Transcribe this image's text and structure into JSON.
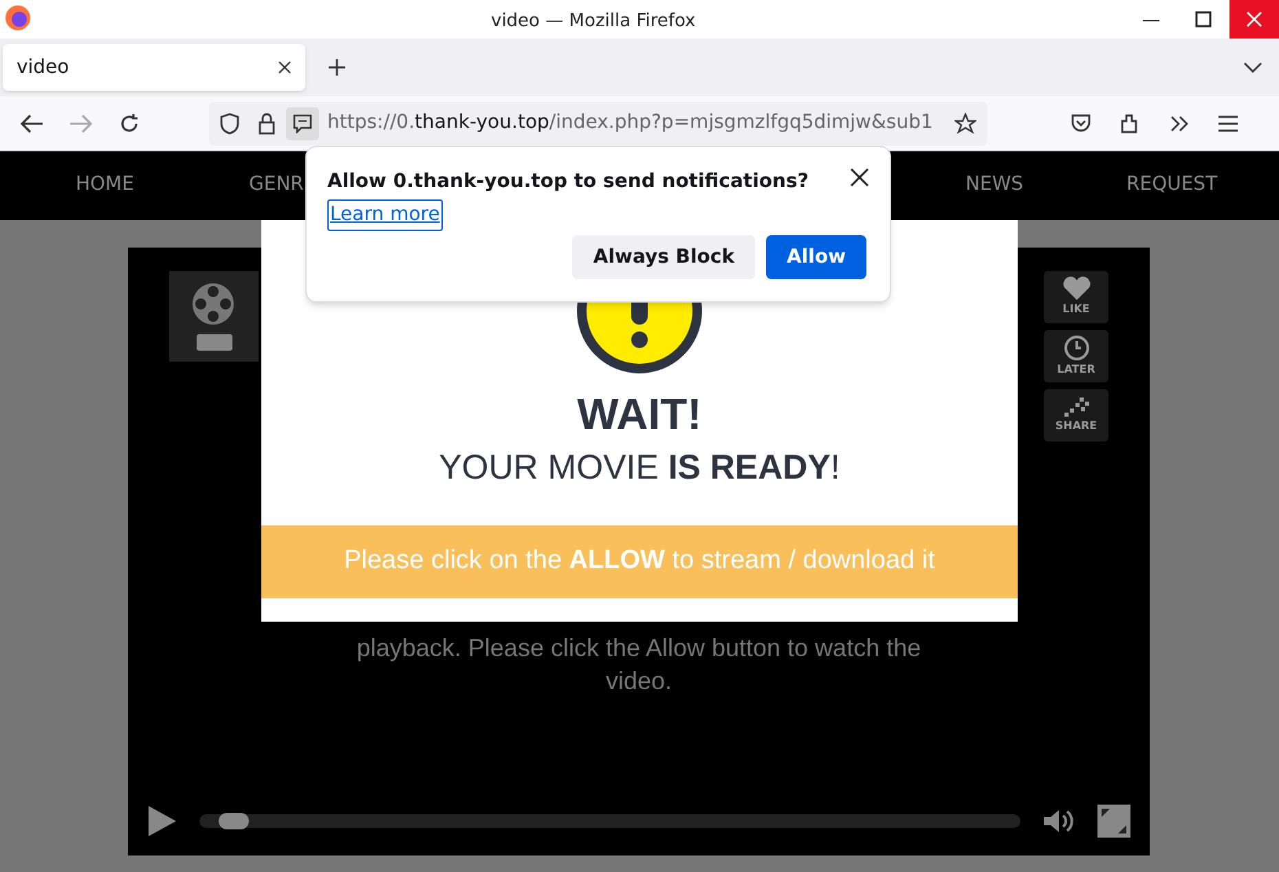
{
  "window": {
    "title": "video — Mozilla Firefox"
  },
  "tabs": [
    {
      "label": "video",
      "selected": true
    }
  ],
  "address_bar": {
    "prefix": "https://0.",
    "domain": "thank-you.top",
    "path": "/index.php?p=mjsgmzlfgq5dimjw&sub1"
  },
  "site_nav": [
    {
      "label": "HOME"
    },
    {
      "label": "GENR"
    },
    {
      "label": "NEWS"
    },
    {
      "label": "REQUEST"
    }
  ],
  "notification_prompt": {
    "message": "Allow 0.thank-you.top to send notifications?",
    "link": "Learn more",
    "buttons": [
      {
        "label": "Always Block",
        "kind": "secondary"
      },
      {
        "label": "Allow",
        "kind": "primary"
      }
    ]
  },
  "player": {
    "side_buttons": [
      {
        "label": "LIKE",
        "kind": "heart"
      },
      {
        "label": "LATER",
        "kind": "clock"
      },
      {
        "label": "SHARE",
        "kind": "share"
      }
    ],
    "message": "playback. Please click the Allow button to watch the video.",
    "seek": {
      "level": 0.03
    }
  },
  "modal": {
    "title": "WAIT!",
    "subtitle": "YOUR MOVIE **IS READY**!",
    "banner": "Please click on the **ALLOW** to stream / download it"
  }
}
